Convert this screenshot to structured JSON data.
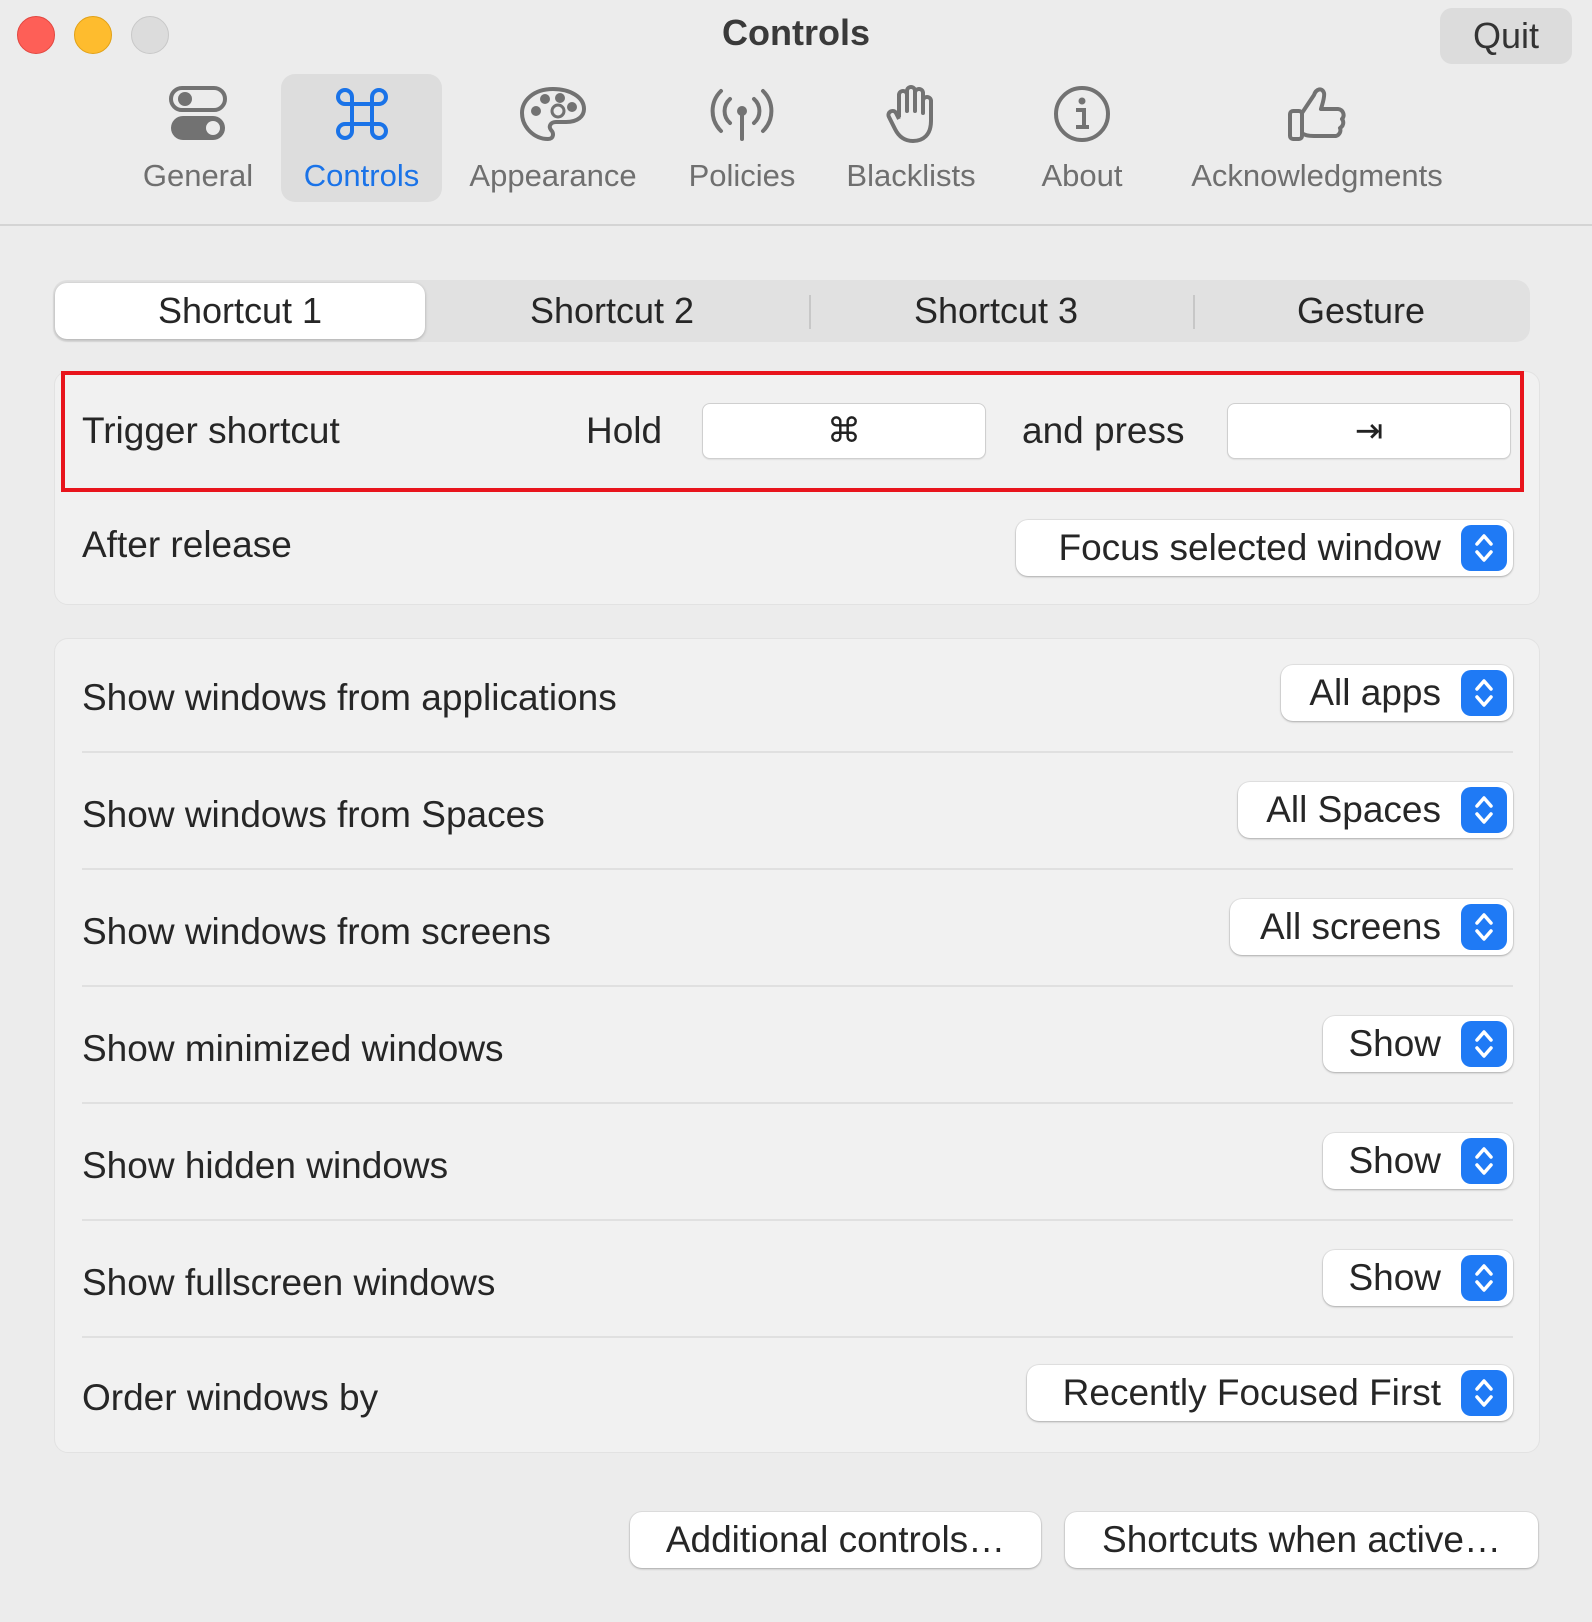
{
  "window": {
    "title": "Controls",
    "quit_label": "Quit"
  },
  "toolbar": {
    "tabs": [
      {
        "label": "General",
        "icon": "toggles-icon"
      },
      {
        "label": "Controls",
        "icon": "command-icon",
        "active": true
      },
      {
        "label": "Appearance",
        "icon": "palette-icon"
      },
      {
        "label": "Policies",
        "icon": "antenna-icon"
      },
      {
        "label": "Blacklists",
        "icon": "hand-icon"
      },
      {
        "label": "About",
        "icon": "info-icon"
      },
      {
        "label": "Acknowledgments",
        "icon": "thumbs-up-icon"
      }
    ]
  },
  "segments": [
    "Shortcut 1",
    "Shortcut 2",
    "Shortcut 3",
    "Gesture"
  ],
  "trigger": {
    "label": "Trigger shortcut",
    "hold_label": "Hold",
    "hold_key": "⌘",
    "press_label": "and press",
    "press_key": "⇥"
  },
  "after_release": {
    "label": "After release",
    "value": "Focus selected window"
  },
  "settings": [
    {
      "label": "Show windows from applications",
      "value": "All apps"
    },
    {
      "label": "Show windows from Spaces",
      "value": "All Spaces"
    },
    {
      "label": "Show windows from screens",
      "value": "All screens"
    },
    {
      "label": "Show minimized windows",
      "value": "Show"
    },
    {
      "label": "Show hidden windows",
      "value": "Show"
    },
    {
      "label": "Show fullscreen windows",
      "value": "Show"
    },
    {
      "label": "Order windows by",
      "value": "Recently Focused First"
    }
  ],
  "buttons": {
    "additional": "Additional controls…",
    "shortcuts_active": "Shortcuts when active…"
  },
  "colors": {
    "accent": "#1f7af5",
    "highlight_border": "#e8141c"
  }
}
